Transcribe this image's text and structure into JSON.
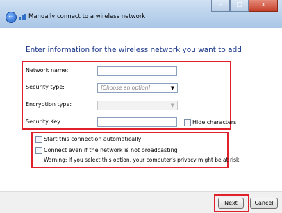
{
  "window": {
    "title": "Manually connect to a wireless network",
    "back_icon": "back-arrow-icon",
    "network_icon": "wireless-network-icon",
    "controls": {
      "minimize": "–",
      "maximize": "□",
      "close": "x"
    }
  },
  "heading": "Enter information for the wireless network you want to add",
  "form": {
    "network_name": {
      "label": "Network name:",
      "value": ""
    },
    "security_type": {
      "label": "Security type:",
      "value": "[Choose an option]"
    },
    "encryption_type": {
      "label": "Encryption type:",
      "value": ""
    },
    "security_key": {
      "label": "Security Key:",
      "value": ""
    },
    "hide_characters": {
      "label": "Hide characters",
      "checked": false
    }
  },
  "options": {
    "start_automatically": {
      "label": "Start this connection automatically",
      "checked": false
    },
    "connect_not_broadcasting": {
      "label": "Connect even if the network is not broadcasting",
      "checked": false
    },
    "warning": "Warning: If you select this option, your computer's privacy might be at risk."
  },
  "buttons": {
    "next": "Next",
    "cancel": "Cancel"
  },
  "colors": {
    "highlight": "#e0202a",
    "heading": "#1e3a8a"
  }
}
